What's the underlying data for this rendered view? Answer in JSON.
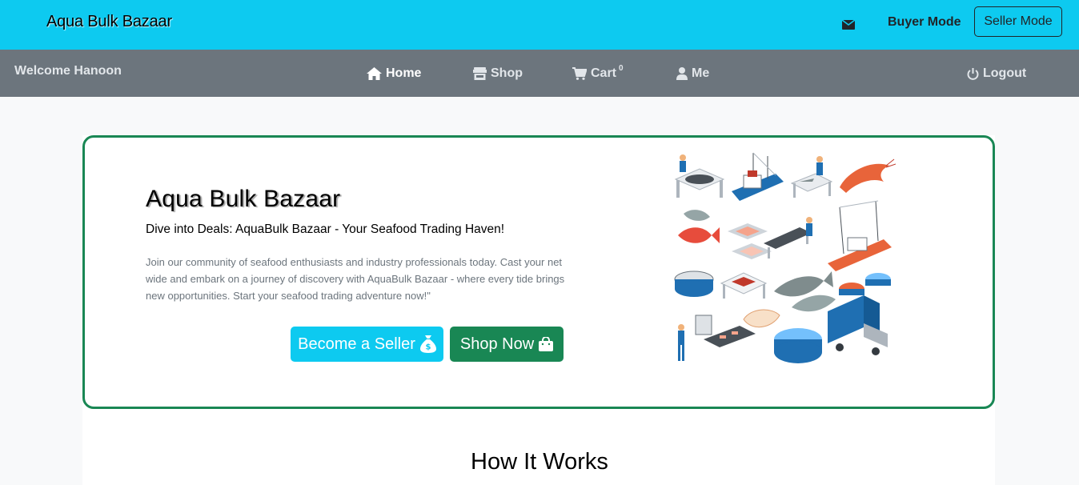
{
  "topbar": {
    "brand": "Aqua Bulk Bazaar",
    "buyer_mode": "Buyer Mode",
    "seller_mode": "Seller Mode",
    "mail_icon": "envelope-icon",
    "background": "#0dcaf0"
  },
  "navbar": {
    "welcome": "Welcome Hanoon",
    "items": [
      {
        "label": "Home",
        "icon": "home-icon"
      },
      {
        "label": "Shop",
        "icon": "store-icon"
      },
      {
        "label": "Cart",
        "icon": "cart-icon"
      },
      {
        "label": "Me",
        "icon": "user-icon"
      }
    ],
    "cart_count": "0",
    "logout": "Logout",
    "background": "#6c757d"
  },
  "hero": {
    "title": "Aqua Bulk Bazaar",
    "subtitle": "Dive into Deals: AquaBulk Bazaar - Your Seafood Trading Haven!",
    "description": "Join our community of seafood enthusiasts and industry professionals today. Cast your net wide and embark on a journey of discovery with AquaBulk Bazaar - where every tide brings new opportunities. Start your seafood trading adventure now!\"",
    "become_seller": "Become a Seller",
    "shop_now": "Shop Now",
    "border_color": "#198754"
  },
  "section": {
    "how_it_works": "How It Works"
  }
}
